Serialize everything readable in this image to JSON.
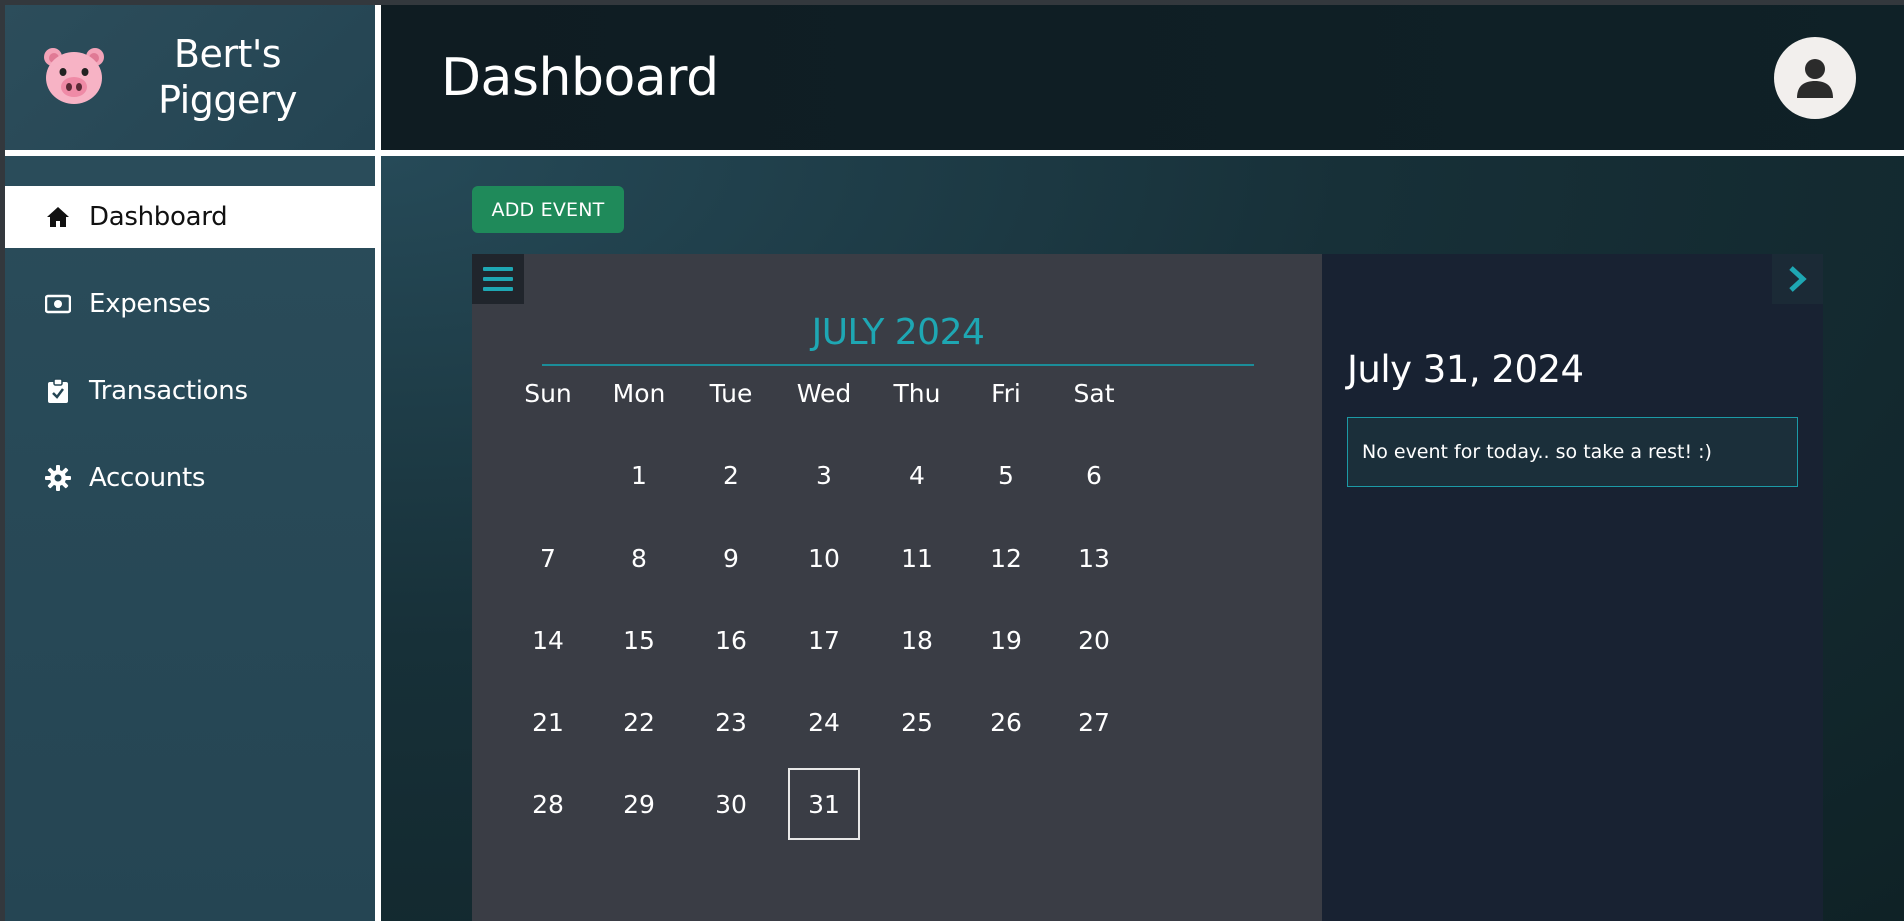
{
  "brand": {
    "name": "Bert's Piggery",
    "logo_icon": "pig-face-icon"
  },
  "header": {
    "title": "Dashboard",
    "avatar_icon": "user-icon"
  },
  "sidebar": {
    "items": [
      {
        "label": "Dashboard",
        "icon": "home-icon",
        "active": true
      },
      {
        "label": "Expenses",
        "icon": "money-bill-icon",
        "active": false
      },
      {
        "label": "Transactions",
        "icon": "clipboard-check-icon",
        "active": false
      },
      {
        "label": "Accounts",
        "icon": "gear-icon",
        "active": false
      }
    ]
  },
  "main": {
    "add_event_label": "ADD EVENT",
    "calendar": {
      "month_title": "JULY 2024",
      "weekdays": [
        "Sun",
        "Mon",
        "Tue",
        "Wed",
        "Thu",
        "Fri",
        "Sat"
      ],
      "first_weekday_index": 1,
      "days_in_month": 31,
      "today": 31
    },
    "events": {
      "selected_date": "July 31, 2024",
      "message": "No event for today.. so take a rest! :)"
    }
  },
  "colors": {
    "accent_teal": "#1ea7b3",
    "button_green": "#1f8a5a",
    "sidebar_bg": "#2a4c5a",
    "header_bg": "#0f1c22",
    "calendar_bg": "#3a3d45",
    "events_bg": "#182232"
  }
}
